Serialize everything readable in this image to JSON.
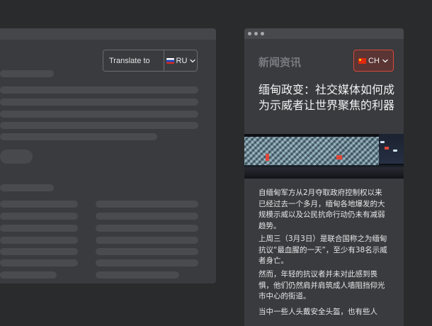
{
  "translator": {
    "label": "Translate to",
    "language_code": "RU"
  },
  "article": {
    "section_label": "新闻资讯",
    "language_code": "CH",
    "headline": "缅甸政变：社交媒体如何成为示威者让世界聚焦的利器",
    "paragraphs": [
      "自缅甸军方从2月夺取政府控制权以来已经过去一个多月，缅甸各地爆发的大规模示威以及公民抗命行动仍未有减弱趋势。",
      "上周三（3月3日）是联合国称之为缅甸抗议“最血腥的一天”，至少有38名示威者身亡。",
      "然而，年轻的抗议者并未对此感到畏惧，他们仍然肩并肩筑成人墙阻挡仰光市中心的街道。",
      "当中一些人头戴安全头盔，也有些人"
    ]
  },
  "icons": {
    "ru_flag": "russia-flag-icon",
    "cn_flag": "china-flag-icon",
    "chevron": "chevron-down-icon"
  },
  "colors": {
    "background": "#2a2b2d",
    "panel": "#3a3b3e",
    "accent_border": "#d7473a",
    "text": "#f2f2f4",
    "muted_label": "#7a7b80"
  }
}
